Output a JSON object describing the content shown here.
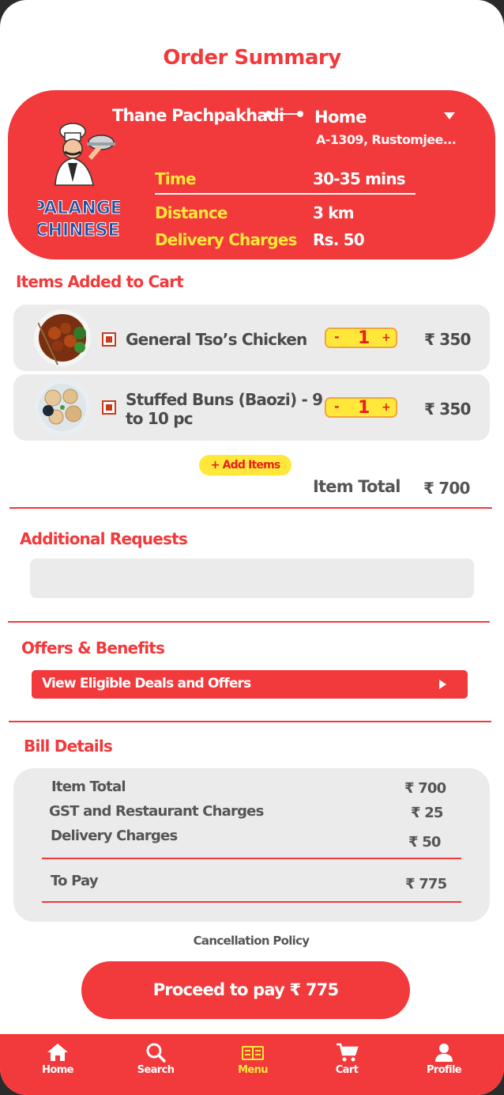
{
  "header": {
    "title": "Order Summary"
  },
  "delivery": {
    "from": "Thane Pachpakhadi",
    "to": "Home",
    "address": "A-1309, Rustomjee...",
    "stats": [
      {
        "label": "Time",
        "value": "30-35 mins"
      },
      {
        "label": "Distance",
        "value": "3 km"
      },
      {
        "label": "Delivery Charges",
        "value": "Rs. 50"
      }
    ],
    "logo": {
      "line1": "PALANGE",
      "line2": "CHINESE"
    }
  },
  "cart": {
    "title": "Items Added to Cart",
    "items": [
      {
        "name": "General Tso’s Chicken",
        "qty": "1",
        "price": "₹ 350",
        "minus": "-",
        "plus": "+"
      },
      {
        "name_line1": "Stuffed Buns (Baozi) - 9",
        "name_line2": "to 10 pc",
        "qty": "1",
        "price": "₹ 350",
        "minus": "-",
        "plus": "+"
      }
    ],
    "add_items_label": "+ Add Items",
    "item_total_label": "Item Total",
    "item_total_value": "₹ 700"
  },
  "requests": {
    "title": "Additional Requests",
    "placeholder": ""
  },
  "offers": {
    "title": "Offers & Benefits",
    "button_label": "View Eligible Deals and Offers"
  },
  "bill": {
    "title": "Bill Details",
    "rows": [
      {
        "label": "Item Total",
        "value": "₹ 700"
      },
      {
        "label": "GST and Restaurant Charges",
        "value": "₹ 25"
      },
      {
        "label": "Delivery Charges",
        "value": "₹ 50"
      }
    ],
    "to_pay_label": "To Pay",
    "to_pay_value": "₹ 775"
  },
  "cancellation_label": "Cancellation Policy",
  "pay_button_label": "Proceed to pay ₹ 775",
  "nav": [
    {
      "label": "Home",
      "icon": "home-icon"
    },
    {
      "label": "Search",
      "icon": "search-icon"
    },
    {
      "label": "Menu",
      "icon": "menu-icon",
      "active": true
    },
    {
      "label": "Cart",
      "icon": "cart-icon"
    },
    {
      "label": "Profile",
      "icon": "profile-icon"
    }
  ],
  "colors": {
    "primary": "#f2393b",
    "accent": "#ffe83a",
    "card": "#ebebeb"
  }
}
